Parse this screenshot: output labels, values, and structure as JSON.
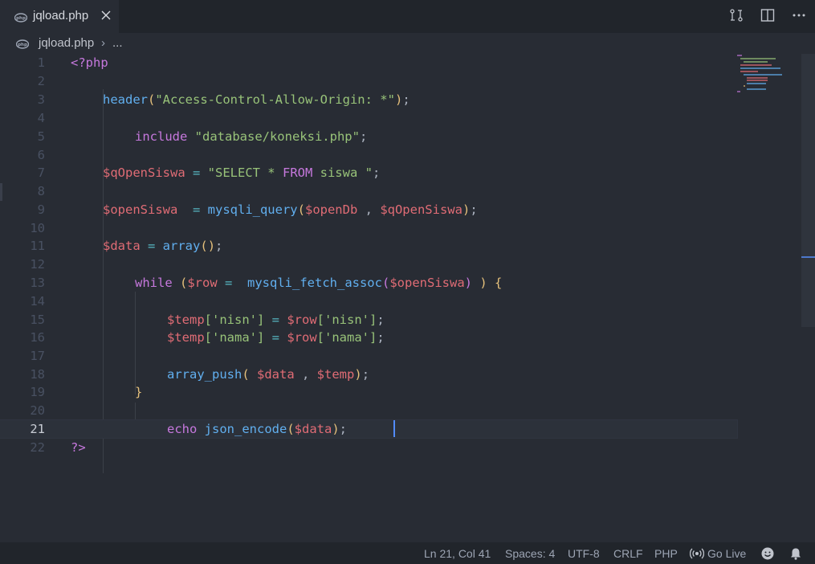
{
  "tab": {
    "file_name": "jqload.php",
    "close_label": "✕"
  },
  "breadcrumb": {
    "file_name": "jqload.php",
    "separator": "›",
    "ellipsis": "..."
  },
  "editor": {
    "cursor": {
      "line": 21,
      "col": 41
    },
    "line_numbers": [
      "1",
      "2",
      "3",
      "4",
      "5",
      "6",
      "7",
      "8",
      "9",
      "10",
      "11",
      "12",
      "13",
      "14",
      "15",
      "16",
      "17",
      "18",
      "19",
      "20",
      "21",
      "22"
    ],
    "code": {
      "l1": [
        "<?php"
      ],
      "l3": [
        "header",
        "(",
        "\"Access-Control-Allow-Origin: *\"",
        ");"
      ],
      "l5": [
        "include",
        " \"database/koneksi.php\"",
        ";"
      ],
      "l7": [
        "$qOpenSiswa",
        " = ",
        "\"SELECT * FROM siswa \"",
        ";"
      ],
      "l9": [
        "$openSiswa",
        "  = ",
        "mysqli_query",
        "(",
        "$openDb",
        " , ",
        "$qOpenSiswa",
        ");"
      ],
      "l11": [
        "$data",
        " = ",
        "array",
        "(",
        ")",
        ";"
      ],
      "l13": [
        "while",
        " (",
        "$row",
        " = ",
        " mysqli_fetch_assoc",
        "(",
        "$openSiswa",
        ") ) ",
        "{"
      ],
      "l15": [
        "$temp",
        "['nisn']",
        " = ",
        "$row",
        "['nisn']",
        ";"
      ],
      "l16": [
        "$temp",
        "['nama']",
        " = ",
        "$row",
        "['nama']",
        ";"
      ],
      "l18": [
        "array_push",
        "( ",
        "$data",
        " , ",
        "$temp",
        ");"
      ],
      "l19": [
        "}"
      ],
      "l21": [
        "echo",
        " json_encode",
        "(",
        "$data",
        ")",
        ";"
      ],
      "l22": [
        "?>"
      ]
    }
  },
  "statusbar": {
    "position": "Ln 21, Col 41",
    "spaces": "Spaces: 4",
    "encoding": "UTF-8",
    "eol": "CRLF",
    "language": "PHP",
    "go_live": "Go Live"
  },
  "colors": {
    "background": "#282c34",
    "keyword": "#c678dd",
    "function": "#61afef",
    "string": "#98c379",
    "variable": "#e06c75",
    "bracket": "#e5c07b",
    "cursor": "#528bff"
  },
  "icons": {
    "tab": "php-file-icon",
    "toolbar": [
      "compare-changes-icon",
      "split-editor-icon",
      "more-actions-icon"
    ],
    "status": [
      "broadcast-icon",
      "feedback-smiley-icon",
      "notifications-bell-icon"
    ]
  }
}
